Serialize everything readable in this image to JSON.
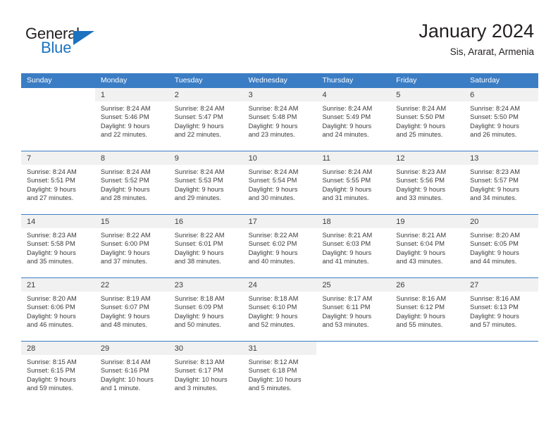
{
  "brand": {
    "name_part1": "General",
    "name_part2": "Blue",
    "logo_icon": "blue-triangle-icon",
    "accent_color": "#1b72c0"
  },
  "header": {
    "title": "January 2024",
    "subtitle": "Sis, Ararat, Armenia"
  },
  "theme": {
    "header_blue": "#3b7dc4",
    "day_band_gray": "#f1f1f1",
    "text_color": "#3b3b3b"
  },
  "weekdays": [
    "Sunday",
    "Monday",
    "Tuesday",
    "Wednesday",
    "Thursday",
    "Friday",
    "Saturday"
  ],
  "weeks": [
    {
      "days": [
        {
          "number": "",
          "empty": true,
          "sunrise": "",
          "sunset": "",
          "daylight_line1": "",
          "daylight_line2": ""
        },
        {
          "number": "1",
          "empty": false,
          "sunrise": "Sunrise: 8:24 AM",
          "sunset": "Sunset: 5:46 PM",
          "daylight_line1": "Daylight: 9 hours",
          "daylight_line2": "and 22 minutes."
        },
        {
          "number": "2",
          "empty": false,
          "sunrise": "Sunrise: 8:24 AM",
          "sunset": "Sunset: 5:47 PM",
          "daylight_line1": "Daylight: 9 hours",
          "daylight_line2": "and 22 minutes."
        },
        {
          "number": "3",
          "empty": false,
          "sunrise": "Sunrise: 8:24 AM",
          "sunset": "Sunset: 5:48 PM",
          "daylight_line1": "Daylight: 9 hours",
          "daylight_line2": "and 23 minutes."
        },
        {
          "number": "4",
          "empty": false,
          "sunrise": "Sunrise: 8:24 AM",
          "sunset": "Sunset: 5:49 PM",
          "daylight_line1": "Daylight: 9 hours",
          "daylight_line2": "and 24 minutes."
        },
        {
          "number": "5",
          "empty": false,
          "sunrise": "Sunrise: 8:24 AM",
          "sunset": "Sunset: 5:50 PM",
          "daylight_line1": "Daylight: 9 hours",
          "daylight_line2": "and 25 minutes."
        },
        {
          "number": "6",
          "empty": false,
          "sunrise": "Sunrise: 8:24 AM",
          "sunset": "Sunset: 5:50 PM",
          "daylight_line1": "Daylight: 9 hours",
          "daylight_line2": "and 26 minutes."
        }
      ]
    },
    {
      "days": [
        {
          "number": "7",
          "empty": false,
          "sunrise": "Sunrise: 8:24 AM",
          "sunset": "Sunset: 5:51 PM",
          "daylight_line1": "Daylight: 9 hours",
          "daylight_line2": "and 27 minutes."
        },
        {
          "number": "8",
          "empty": false,
          "sunrise": "Sunrise: 8:24 AM",
          "sunset": "Sunset: 5:52 PM",
          "daylight_line1": "Daylight: 9 hours",
          "daylight_line2": "and 28 minutes."
        },
        {
          "number": "9",
          "empty": false,
          "sunrise": "Sunrise: 8:24 AM",
          "sunset": "Sunset: 5:53 PM",
          "daylight_line1": "Daylight: 9 hours",
          "daylight_line2": "and 29 minutes."
        },
        {
          "number": "10",
          "empty": false,
          "sunrise": "Sunrise: 8:24 AM",
          "sunset": "Sunset: 5:54 PM",
          "daylight_line1": "Daylight: 9 hours",
          "daylight_line2": "and 30 minutes."
        },
        {
          "number": "11",
          "empty": false,
          "sunrise": "Sunrise: 8:24 AM",
          "sunset": "Sunset: 5:55 PM",
          "daylight_line1": "Daylight: 9 hours",
          "daylight_line2": "and 31 minutes."
        },
        {
          "number": "12",
          "empty": false,
          "sunrise": "Sunrise: 8:23 AM",
          "sunset": "Sunset: 5:56 PM",
          "daylight_line1": "Daylight: 9 hours",
          "daylight_line2": "and 33 minutes."
        },
        {
          "number": "13",
          "empty": false,
          "sunrise": "Sunrise: 8:23 AM",
          "sunset": "Sunset: 5:57 PM",
          "daylight_line1": "Daylight: 9 hours",
          "daylight_line2": "and 34 minutes."
        }
      ]
    },
    {
      "days": [
        {
          "number": "14",
          "empty": false,
          "sunrise": "Sunrise: 8:23 AM",
          "sunset": "Sunset: 5:58 PM",
          "daylight_line1": "Daylight: 9 hours",
          "daylight_line2": "and 35 minutes."
        },
        {
          "number": "15",
          "empty": false,
          "sunrise": "Sunrise: 8:22 AM",
          "sunset": "Sunset: 6:00 PM",
          "daylight_line1": "Daylight: 9 hours",
          "daylight_line2": "and 37 minutes."
        },
        {
          "number": "16",
          "empty": false,
          "sunrise": "Sunrise: 8:22 AM",
          "sunset": "Sunset: 6:01 PM",
          "daylight_line1": "Daylight: 9 hours",
          "daylight_line2": "and 38 minutes."
        },
        {
          "number": "17",
          "empty": false,
          "sunrise": "Sunrise: 8:22 AM",
          "sunset": "Sunset: 6:02 PM",
          "daylight_line1": "Daylight: 9 hours",
          "daylight_line2": "and 40 minutes."
        },
        {
          "number": "18",
          "empty": false,
          "sunrise": "Sunrise: 8:21 AM",
          "sunset": "Sunset: 6:03 PM",
          "daylight_line1": "Daylight: 9 hours",
          "daylight_line2": "and 41 minutes."
        },
        {
          "number": "19",
          "empty": false,
          "sunrise": "Sunrise: 8:21 AM",
          "sunset": "Sunset: 6:04 PM",
          "daylight_line1": "Daylight: 9 hours",
          "daylight_line2": "and 43 minutes."
        },
        {
          "number": "20",
          "empty": false,
          "sunrise": "Sunrise: 8:20 AM",
          "sunset": "Sunset: 6:05 PM",
          "daylight_line1": "Daylight: 9 hours",
          "daylight_line2": "and 44 minutes."
        }
      ]
    },
    {
      "days": [
        {
          "number": "21",
          "empty": false,
          "sunrise": "Sunrise: 8:20 AM",
          "sunset": "Sunset: 6:06 PM",
          "daylight_line1": "Daylight: 9 hours",
          "daylight_line2": "and 46 minutes."
        },
        {
          "number": "22",
          "empty": false,
          "sunrise": "Sunrise: 8:19 AM",
          "sunset": "Sunset: 6:07 PM",
          "daylight_line1": "Daylight: 9 hours",
          "daylight_line2": "and 48 minutes."
        },
        {
          "number": "23",
          "empty": false,
          "sunrise": "Sunrise: 8:18 AM",
          "sunset": "Sunset: 6:09 PM",
          "daylight_line1": "Daylight: 9 hours",
          "daylight_line2": "and 50 minutes."
        },
        {
          "number": "24",
          "empty": false,
          "sunrise": "Sunrise: 8:18 AM",
          "sunset": "Sunset: 6:10 PM",
          "daylight_line1": "Daylight: 9 hours",
          "daylight_line2": "and 52 minutes."
        },
        {
          "number": "25",
          "empty": false,
          "sunrise": "Sunrise: 8:17 AM",
          "sunset": "Sunset: 6:11 PM",
          "daylight_line1": "Daylight: 9 hours",
          "daylight_line2": "and 53 minutes."
        },
        {
          "number": "26",
          "empty": false,
          "sunrise": "Sunrise: 8:16 AM",
          "sunset": "Sunset: 6:12 PM",
          "daylight_line1": "Daylight: 9 hours",
          "daylight_line2": "and 55 minutes."
        },
        {
          "number": "27",
          "empty": false,
          "sunrise": "Sunrise: 8:16 AM",
          "sunset": "Sunset: 6:13 PM",
          "daylight_line1": "Daylight: 9 hours",
          "daylight_line2": "and 57 minutes."
        }
      ]
    },
    {
      "days": [
        {
          "number": "28",
          "empty": false,
          "sunrise": "Sunrise: 8:15 AM",
          "sunset": "Sunset: 6:15 PM",
          "daylight_line1": "Daylight: 9 hours",
          "daylight_line2": "and 59 minutes."
        },
        {
          "number": "29",
          "empty": false,
          "sunrise": "Sunrise: 8:14 AM",
          "sunset": "Sunset: 6:16 PM",
          "daylight_line1": "Daylight: 10 hours",
          "daylight_line2": "and 1 minute."
        },
        {
          "number": "30",
          "empty": false,
          "sunrise": "Sunrise: 8:13 AM",
          "sunset": "Sunset: 6:17 PM",
          "daylight_line1": "Daylight: 10 hours",
          "daylight_line2": "and 3 minutes."
        },
        {
          "number": "31",
          "empty": false,
          "sunrise": "Sunrise: 8:12 AM",
          "sunset": "Sunset: 6:18 PM",
          "daylight_line1": "Daylight: 10 hours",
          "daylight_line2": "and 5 minutes."
        },
        {
          "number": "",
          "empty": true,
          "sunrise": "",
          "sunset": "",
          "daylight_line1": "",
          "daylight_line2": ""
        },
        {
          "number": "",
          "empty": true,
          "sunrise": "",
          "sunset": "",
          "daylight_line1": "",
          "daylight_line2": ""
        },
        {
          "number": "",
          "empty": true,
          "sunrise": "",
          "sunset": "",
          "daylight_line1": "",
          "daylight_line2": ""
        }
      ]
    }
  ]
}
